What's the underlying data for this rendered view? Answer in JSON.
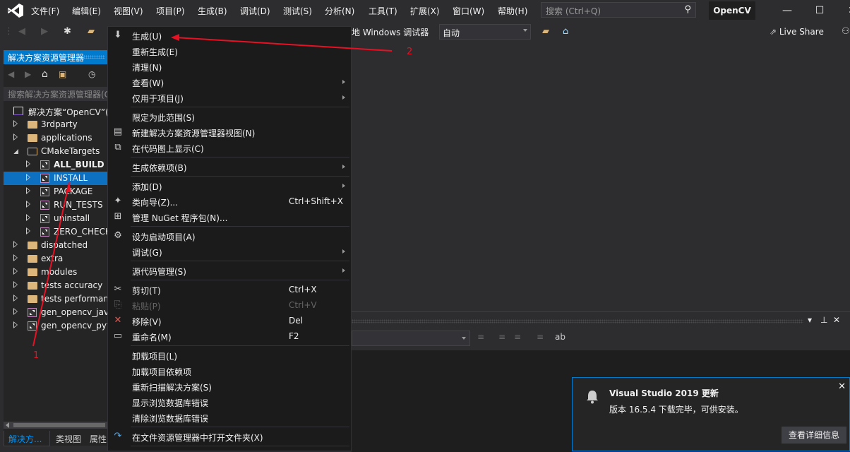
{
  "titlebar": {
    "menu": [
      "文件(F)",
      "编辑(E)",
      "视图(V)",
      "项目(P)",
      "生成(B)",
      "调试(D)",
      "测试(S)",
      "分析(N)",
      "工具(T)",
      "扩展(X)",
      "窗口(W)",
      "帮助(H)"
    ],
    "search_placeholder": "搜索 (Ctrl+Q)",
    "project_name": "OpenCV",
    "minimize": "—",
    "maximize": "☐",
    "close": "✕"
  },
  "toolbar": {
    "debugger_label": "地 Windows 调试器",
    "config_value": "自动",
    "live_share": "Live Share"
  },
  "solution_explorer": {
    "title": "解决方案资源管理器",
    "search_placeholder": "搜索解决方案资源管理器(Ctrl+;)",
    "tree": [
      {
        "label": "解决方案“OpenCV”(",
        "type": "solution",
        "level": 0
      },
      {
        "label": "3rdparty",
        "type": "folder",
        "level": 1
      },
      {
        "label": "applications",
        "type": "folder",
        "level": 1
      },
      {
        "label": "CMakeTargets",
        "type": "folder-open",
        "level": 1
      },
      {
        "label": "ALL_BUILD",
        "type": "project",
        "level": 2,
        "bold": true
      },
      {
        "label": "INSTALL",
        "type": "project",
        "level": 2,
        "selected": true
      },
      {
        "label": "PACKAGE",
        "type": "project",
        "level": 2
      },
      {
        "label": "RUN_TESTS",
        "type": "project",
        "level": 2
      },
      {
        "label": "uninstall",
        "type": "project",
        "level": 2
      },
      {
        "label": "ZERO_CHECK",
        "type": "project",
        "level": 2
      },
      {
        "label": "dispatched",
        "type": "folder",
        "level": 1
      },
      {
        "label": "extra",
        "type": "folder",
        "level": 1
      },
      {
        "label": "modules",
        "type": "folder",
        "level": 1
      },
      {
        "label": "tests accuracy",
        "type": "folder",
        "level": 1
      },
      {
        "label": "tests performance",
        "type": "folder",
        "level": 1
      },
      {
        "label": "gen_opencv_java",
        "type": "project",
        "level": 1
      },
      {
        "label": "gen_opencv_python",
        "type": "project",
        "level": 1
      }
    ],
    "bottom_tabs": [
      "解决方...",
      "类视图",
      "属性"
    ]
  },
  "context_menu": {
    "items": [
      {
        "label": "生成(U)",
        "icon": "build-icon"
      },
      {
        "label": "重新生成(E)"
      },
      {
        "label": "清理(N)"
      },
      {
        "label": "查看(W)",
        "submenu": true
      },
      {
        "label": "仅用于项目(J)",
        "submenu": true
      },
      {
        "sep": true
      },
      {
        "label": "限定为此范围(S)"
      },
      {
        "label": "新建解决方案资源管理器视图(N)",
        "icon": "new-view-icon"
      },
      {
        "label": "在代码图上显示(C)",
        "icon": "code-map-icon"
      },
      {
        "sep": true
      },
      {
        "label": "生成依赖项(B)",
        "submenu": true
      },
      {
        "sep": true
      },
      {
        "label": "添加(D)",
        "submenu": true
      },
      {
        "label": "类向导(Z)...",
        "shortcut": "Ctrl+Shift+X",
        "icon": "class-wizard-icon"
      },
      {
        "label": "管理 NuGet 程序包(N)...",
        "icon": "nuget-icon"
      },
      {
        "sep": true
      },
      {
        "label": "设为启动项目(A)",
        "icon": "gear-icon"
      },
      {
        "label": "调试(G)",
        "submenu": true
      },
      {
        "sep": true
      },
      {
        "label": "源代码管理(S)",
        "submenu": true
      },
      {
        "sep": true
      },
      {
        "label": "剪切(T)",
        "shortcut": "Ctrl+X",
        "icon": "scissors-icon"
      },
      {
        "label": "粘贴(P)",
        "shortcut": "Ctrl+V",
        "icon": "paste-icon",
        "disabled": true
      },
      {
        "label": "移除(V)",
        "shortcut": "Del",
        "icon": "remove-icon"
      },
      {
        "label": "重命名(M)",
        "shortcut": "F2",
        "icon": "rename-icon"
      },
      {
        "sep": true
      },
      {
        "label": "卸载项目(L)"
      },
      {
        "label": "加载项目依赖项"
      },
      {
        "label": "重新扫描解决方案(S)"
      },
      {
        "label": "显示浏览数据库错误"
      },
      {
        "label": "清除浏览数据库错误"
      },
      {
        "sep": true
      },
      {
        "label": "在文件资源管理器中打开文件夹(X)",
        "icon": "open-folder-arrow-icon"
      },
      {
        "sep": true
      }
    ]
  },
  "notification": {
    "title": "Visual Studio 2019 更新",
    "message": "版本 16.5.4 下载完毕，可供安装。",
    "button": "查看详细信息",
    "close": "✕"
  },
  "annotations": {
    "label_1": "1",
    "label_2": "2",
    "color": "#e81123"
  }
}
